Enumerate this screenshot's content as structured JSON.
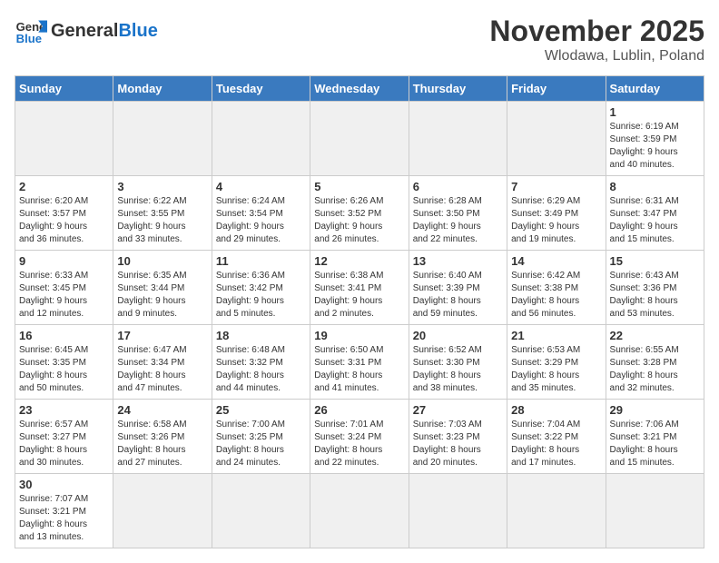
{
  "header": {
    "logo_general": "General",
    "logo_blue": "Blue",
    "month_title": "November 2025",
    "location": "Wlodawa, Lublin, Poland"
  },
  "weekdays": [
    "Sunday",
    "Monday",
    "Tuesday",
    "Wednesday",
    "Thursday",
    "Friday",
    "Saturday"
  ],
  "weeks": [
    [
      {
        "day": "",
        "empty": true
      },
      {
        "day": "",
        "empty": true
      },
      {
        "day": "",
        "empty": true
      },
      {
        "day": "",
        "empty": true
      },
      {
        "day": "",
        "empty": true
      },
      {
        "day": "",
        "empty": true
      },
      {
        "day": "1",
        "sunrise": "6:19 AM",
        "sunset": "3:59 PM",
        "daylight_hours": "9 hours",
        "daylight_minutes": "and 40 minutes."
      }
    ],
    [
      {
        "day": "2",
        "sunrise": "6:20 AM",
        "sunset": "3:57 PM",
        "daylight_hours": "9 hours",
        "daylight_minutes": "and 36 minutes."
      },
      {
        "day": "3",
        "sunrise": "6:22 AM",
        "sunset": "3:55 PM",
        "daylight_hours": "9 hours",
        "daylight_minutes": "and 33 minutes."
      },
      {
        "day": "4",
        "sunrise": "6:24 AM",
        "sunset": "3:54 PM",
        "daylight_hours": "9 hours",
        "daylight_minutes": "and 29 minutes."
      },
      {
        "day": "5",
        "sunrise": "6:26 AM",
        "sunset": "3:52 PM",
        "daylight_hours": "9 hours",
        "daylight_minutes": "and 26 minutes."
      },
      {
        "day": "6",
        "sunrise": "6:28 AM",
        "sunset": "3:50 PM",
        "daylight_hours": "9 hours",
        "daylight_minutes": "and 22 minutes."
      },
      {
        "day": "7",
        "sunrise": "6:29 AM",
        "sunset": "3:49 PM",
        "daylight_hours": "9 hours",
        "daylight_minutes": "and 19 minutes."
      },
      {
        "day": "8",
        "sunrise": "6:31 AM",
        "sunset": "3:47 PM",
        "daylight_hours": "9 hours",
        "daylight_minutes": "and 15 minutes."
      }
    ],
    [
      {
        "day": "9",
        "sunrise": "6:33 AM",
        "sunset": "3:45 PM",
        "daylight_hours": "9 hours",
        "daylight_minutes": "and 12 minutes."
      },
      {
        "day": "10",
        "sunrise": "6:35 AM",
        "sunset": "3:44 PM",
        "daylight_hours": "9 hours",
        "daylight_minutes": "and 9 minutes."
      },
      {
        "day": "11",
        "sunrise": "6:36 AM",
        "sunset": "3:42 PM",
        "daylight_hours": "9 hours",
        "daylight_minutes": "and 5 minutes."
      },
      {
        "day": "12",
        "sunrise": "6:38 AM",
        "sunset": "3:41 PM",
        "daylight_hours": "9 hours",
        "daylight_minutes": "and 2 minutes."
      },
      {
        "day": "13",
        "sunrise": "6:40 AM",
        "sunset": "3:39 PM",
        "daylight_hours": "8 hours",
        "daylight_minutes": "and 59 minutes."
      },
      {
        "day": "14",
        "sunrise": "6:42 AM",
        "sunset": "3:38 PM",
        "daylight_hours": "8 hours",
        "daylight_minutes": "and 56 minutes."
      },
      {
        "day": "15",
        "sunrise": "6:43 AM",
        "sunset": "3:36 PM",
        "daylight_hours": "8 hours",
        "daylight_minutes": "and 53 minutes."
      }
    ],
    [
      {
        "day": "16",
        "sunrise": "6:45 AM",
        "sunset": "3:35 PM",
        "daylight_hours": "8 hours",
        "daylight_minutes": "and 50 minutes."
      },
      {
        "day": "17",
        "sunrise": "6:47 AM",
        "sunset": "3:34 PM",
        "daylight_hours": "8 hours",
        "daylight_minutes": "and 47 minutes."
      },
      {
        "day": "18",
        "sunrise": "6:48 AM",
        "sunset": "3:32 PM",
        "daylight_hours": "8 hours",
        "daylight_minutes": "and 44 minutes."
      },
      {
        "day": "19",
        "sunrise": "6:50 AM",
        "sunset": "3:31 PM",
        "daylight_hours": "8 hours",
        "daylight_minutes": "and 41 minutes."
      },
      {
        "day": "20",
        "sunrise": "6:52 AM",
        "sunset": "3:30 PM",
        "daylight_hours": "8 hours",
        "daylight_minutes": "and 38 minutes."
      },
      {
        "day": "21",
        "sunrise": "6:53 AM",
        "sunset": "3:29 PM",
        "daylight_hours": "8 hours",
        "daylight_minutes": "and 35 minutes."
      },
      {
        "day": "22",
        "sunrise": "6:55 AM",
        "sunset": "3:28 PM",
        "daylight_hours": "8 hours",
        "daylight_minutes": "and 32 minutes."
      }
    ],
    [
      {
        "day": "23",
        "sunrise": "6:57 AM",
        "sunset": "3:27 PM",
        "daylight_hours": "8 hours",
        "daylight_minutes": "and 30 minutes."
      },
      {
        "day": "24",
        "sunrise": "6:58 AM",
        "sunset": "3:26 PM",
        "daylight_hours": "8 hours",
        "daylight_minutes": "and 27 minutes."
      },
      {
        "day": "25",
        "sunrise": "7:00 AM",
        "sunset": "3:25 PM",
        "daylight_hours": "8 hours",
        "daylight_minutes": "and 24 minutes."
      },
      {
        "day": "26",
        "sunrise": "7:01 AM",
        "sunset": "3:24 PM",
        "daylight_hours": "8 hours",
        "daylight_minutes": "and 22 minutes."
      },
      {
        "day": "27",
        "sunrise": "7:03 AM",
        "sunset": "3:23 PM",
        "daylight_hours": "8 hours",
        "daylight_minutes": "and 20 minutes."
      },
      {
        "day": "28",
        "sunrise": "7:04 AM",
        "sunset": "3:22 PM",
        "daylight_hours": "8 hours",
        "daylight_minutes": "and 17 minutes."
      },
      {
        "day": "29",
        "sunrise": "7:06 AM",
        "sunset": "3:21 PM",
        "daylight_hours": "8 hours",
        "daylight_minutes": "and 15 minutes."
      }
    ],
    [
      {
        "day": "30",
        "sunrise": "7:07 AM",
        "sunset": "3:21 PM",
        "daylight_hours": "8 hours",
        "daylight_minutes": "and 13 minutes."
      },
      {
        "day": "",
        "empty": true
      },
      {
        "day": "",
        "empty": true
      },
      {
        "day": "",
        "empty": true
      },
      {
        "day": "",
        "empty": true
      },
      {
        "day": "",
        "empty": true
      },
      {
        "day": "",
        "empty": true
      }
    ]
  ]
}
